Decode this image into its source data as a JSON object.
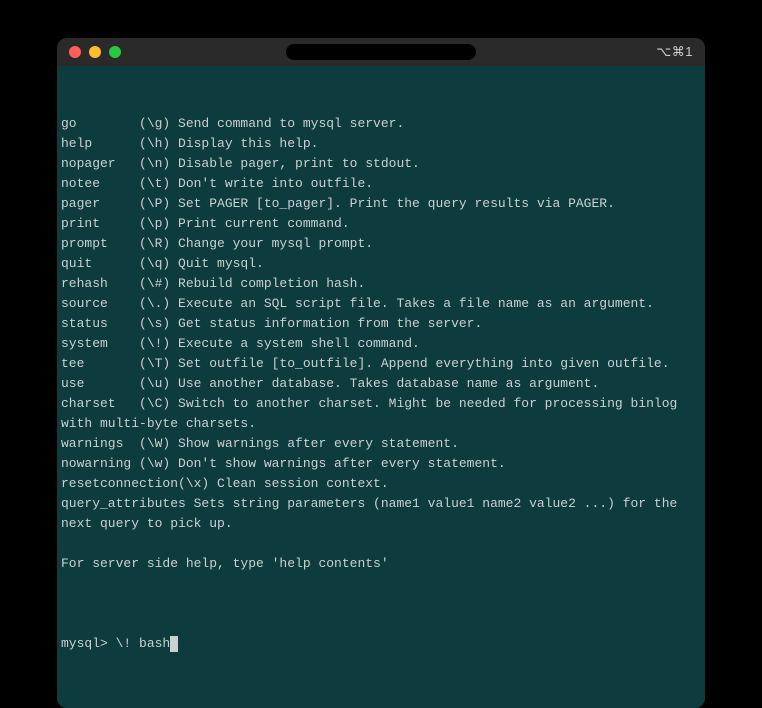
{
  "titlebar": {
    "shortcut": "⌥⌘1"
  },
  "help_lines": [
    "go        (\\g) Send command to mysql server.",
    "help      (\\h) Display this help.",
    "nopager   (\\n) Disable pager, print to stdout.",
    "notee     (\\t) Don't write into outfile.",
    "pager     (\\P) Set PAGER [to_pager]. Print the query results via PAGER.",
    "print     (\\p) Print current command.",
    "prompt    (\\R) Change your mysql prompt.",
    "quit      (\\q) Quit mysql.",
    "rehash    (\\#) Rebuild completion hash.",
    "source    (\\.) Execute an SQL script file. Takes a file name as an argument.",
    "status    (\\s) Get status information from the server.",
    "system    (\\!) Execute a system shell command.",
    "tee       (\\T) Set outfile [to_outfile]. Append everything into given outfile.",
    "use       (\\u) Use another database. Takes database name as argument.",
    "charset   (\\C) Switch to another charset. Might be needed for processing binlog with multi-byte charsets.",
    "warnings  (\\W) Show warnings after every statement.",
    "nowarning (\\w) Don't show warnings after every statement.",
    "resetconnection(\\x) Clean session context.",
    "query_attributes Sets string parameters (name1 value1 name2 value2 ...) for the next query to pick up.",
    "",
    "For server side help, type 'help contents'",
    ""
  ],
  "prompt": {
    "prefix": "mysql> ",
    "input": "\\! bash"
  }
}
